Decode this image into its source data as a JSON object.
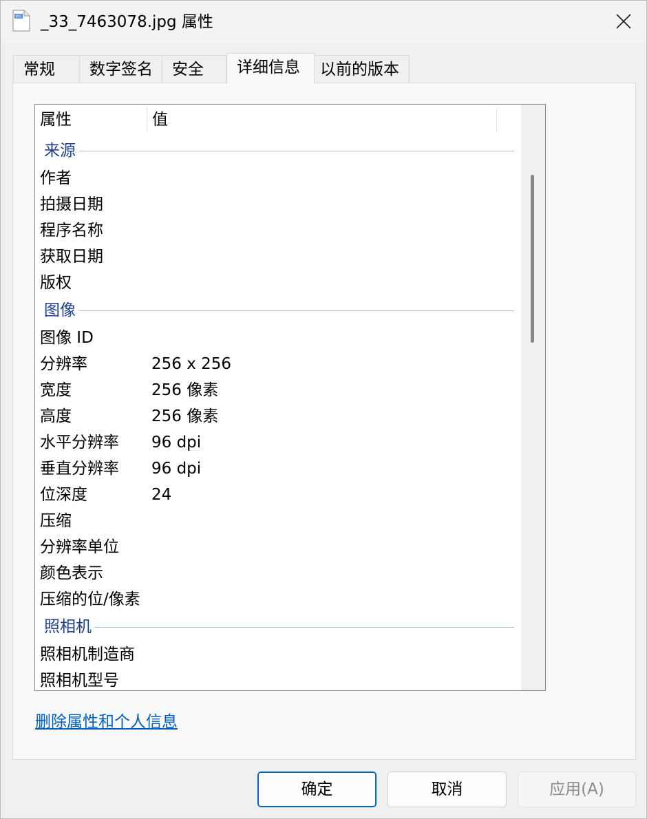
{
  "window": {
    "title": "_33_7463078.jpg 属性",
    "icon_text": "JPG"
  },
  "tabs": [
    {
      "label": "常规"
    },
    {
      "label": "数字签名"
    },
    {
      "label": "安全"
    },
    {
      "label": "详细信息",
      "active": true
    },
    {
      "label": "以前的版本"
    }
  ],
  "list": {
    "headers": {
      "property": "属性",
      "value": "值"
    },
    "groups": [
      {
        "name": "来源",
        "rows": [
          {
            "prop": "作者",
            "val": ""
          },
          {
            "prop": "拍摄日期",
            "val": ""
          },
          {
            "prop": "程序名称",
            "val": ""
          },
          {
            "prop": "获取日期",
            "val": ""
          },
          {
            "prop": "版权",
            "val": ""
          }
        ]
      },
      {
        "name": "图像",
        "rows": [
          {
            "prop": "图像 ID",
            "val": ""
          },
          {
            "prop": "分辨率",
            "val": "256 x 256"
          },
          {
            "prop": "宽度",
            "val": "256 像素"
          },
          {
            "prop": "高度",
            "val": "256 像素"
          },
          {
            "prop": "水平分辨率",
            "val": "96 dpi"
          },
          {
            "prop": "垂直分辨率",
            "val": "96 dpi"
          },
          {
            "prop": "位深度",
            "val": "24"
          },
          {
            "prop": "压缩",
            "val": ""
          },
          {
            "prop": "分辨率单位",
            "val": ""
          },
          {
            "prop": "颜色表示",
            "val": ""
          },
          {
            "prop": "压缩的位/像素",
            "val": ""
          }
        ]
      },
      {
        "name": "照相机",
        "rows": [
          {
            "prop": "照相机制造商",
            "val": ""
          },
          {
            "prop": "照相机型号",
            "val": ""
          }
        ]
      }
    ]
  },
  "link": {
    "remove_properties": "删除属性和个人信息"
  },
  "buttons": {
    "ok": "确定",
    "cancel": "取消",
    "apply": "应用(A)"
  },
  "colors": {
    "group_header": "#1e3f90",
    "link": "#0060c0",
    "primary_border": "#0067c0"
  }
}
